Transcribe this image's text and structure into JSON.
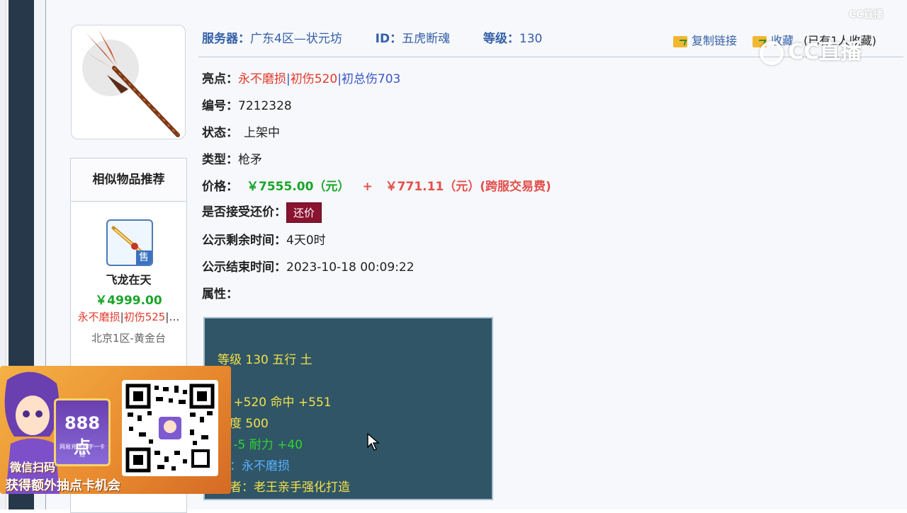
{
  "header": {
    "server_label": "服务器：",
    "server_value": "广东4区—状元坊",
    "id_label": "ID：",
    "id_value": "五虎断魂",
    "level_label": "等级：",
    "level_value": "130",
    "copy_link": "复制链接",
    "favorite": "收藏",
    "favorite_count": "(已有1人收藏)"
  },
  "details": {
    "highlight_label": "亮点：",
    "highlight_tags": [
      "永不磨损",
      "初伤520",
      "初总伤703"
    ],
    "number_label": "编号：",
    "number_value": "7212328",
    "status_label": "状态：",
    "status_value": "上架中",
    "type_label": "类型：",
    "type_value": "枪矛",
    "price_label": "价格：",
    "price_value": "￥7555.00（元）",
    "price_plus": "+",
    "fee_value": "￥771.11（元）(跨服交易费)",
    "bargain_label": "是否接受还价：",
    "bargain_button": "还价",
    "remaining_label": "公示剩余时间：",
    "remaining_value": "4天0时",
    "end_label": "公示结束时间：",
    "end_value": "2023-10-18 00:09:22",
    "attr_label": "属性："
  },
  "attributes": {
    "line1": "等级 130 五行 土",
    "line2": "害 +520 命中 +551",
    "line3": "久度 500",
    "line4": "量 -5 耐力 +40",
    "line5": "效：永不磨损",
    "line6": "造者：老王亲手强化打造"
  },
  "similar": {
    "title": "相似物品推荐",
    "sell_badge": "售",
    "name": "飞龙在天",
    "price": "￥4999.00",
    "tag1": "永不磨损",
    "tag2": "初伤525",
    "tag_more": "|…",
    "server": "北京1区-黄金台"
  },
  "promo": {
    "card_number": "888点",
    "card_sub": "网易充值数字一卡通",
    "line1": "微信扫码",
    "line2": "获得额外抽点卡机会"
  },
  "watermark": {
    "small": "CC直播",
    "big": "CC直播"
  },
  "colors": {
    "label_blue": "#3560a8",
    "price_green": "#1aa52a",
    "fee_pink": "#e2504c",
    "tag_red": "#e23a2a",
    "tag_blue": "#3a55c7",
    "bargain_bg": "#8a1330",
    "attr_box_bg": "#2f5566"
  }
}
